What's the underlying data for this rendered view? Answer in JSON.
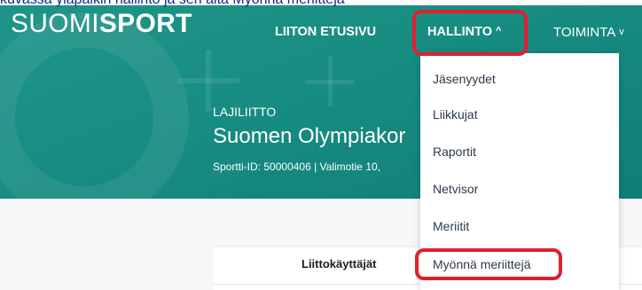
{
  "logo": {
    "part1": "SUOMI",
    "part2": "SPORT"
  },
  "nav": {
    "liiton_etusivu": "LIITON ETUSIVU",
    "hallinto": "HALLINTO",
    "toiminta": "TOIMINTA",
    "chevron_up": "^",
    "chevron_down": "v"
  },
  "top_partial_text": "kuvassa yläpalkin hallinto ja sen alta Myönnä meriitteja",
  "org": {
    "type": "LAJILIITTO",
    "name": "Suomen Olympiakor",
    "info": "Sportti-ID: 50000406 | Valimotie 10,"
  },
  "hallinto_menu": {
    "items": [
      "Jäsenyydet",
      "Liikkujat",
      "Raportit",
      "Netvisor",
      "Meriitit",
      "Myönnä meriittejä"
    ]
  },
  "card": {
    "tab": "Liittokäyttäjät"
  },
  "colors": {
    "teal": "#1f958a",
    "highlight": "#e0202f"
  }
}
